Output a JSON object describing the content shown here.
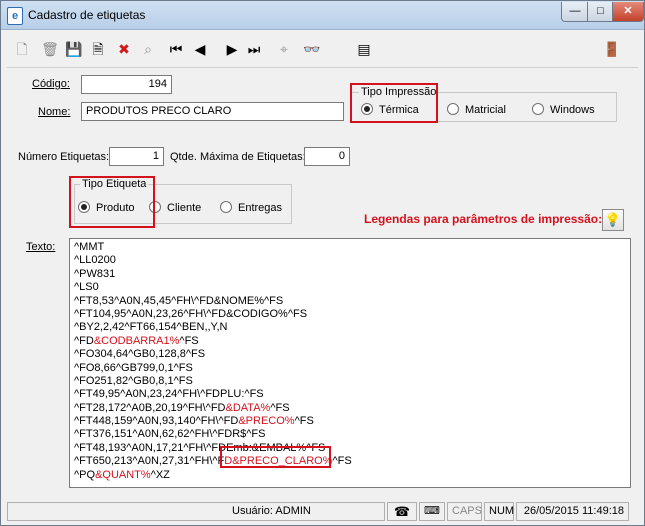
{
  "window": {
    "title": "Cadastro de etiquetas",
    "minimize": "—",
    "maximize": "□",
    "close": "✕"
  },
  "toolbar": {
    "icons": [
      {
        "name": "new-icon",
        "glyph": "🗋"
      },
      {
        "name": "trash-icon",
        "glyph": "🗑"
      },
      {
        "name": "save-icon",
        "glyph": "💾"
      },
      {
        "name": "edit-icon",
        "glyph": "🗎"
      },
      {
        "name": "delete-icon",
        "glyph": "✖"
      },
      {
        "name": "search-icon",
        "glyph": "⌕"
      },
      {
        "name": "first-record-icon",
        "glyph": "⏮"
      },
      {
        "name": "previous-record-icon",
        "glyph": "◀"
      },
      {
        "name": "next-record-icon",
        "glyph": "▶"
      },
      {
        "name": "last-record-icon",
        "glyph": "⏭"
      },
      {
        "name": "filter-icon",
        "glyph": "⌖"
      },
      {
        "name": "binoculars-icon",
        "glyph": "👓"
      },
      {
        "name": "report-icon",
        "glyph": "▤"
      },
      {
        "name": "exit-icon",
        "glyph": "🚪"
      }
    ]
  },
  "form": {
    "codigo_label": "Código:",
    "codigo_value": "194",
    "nome_label": "Nome:",
    "nome_value": "PRODUTOS PRECO CLARO",
    "tipo_impressao": {
      "title": "Tipo Impressão",
      "options": [
        "Térmica",
        "Matricial",
        "Windows"
      ],
      "selected": "Térmica"
    },
    "numero_etiquetas_label": "Número Etiquetas:",
    "numero_etiquetas_value": "1",
    "qtde_maxima_label": "Qtde. Máxima de Etiquetas:",
    "qtde_maxima_value": "0",
    "tipo_etiqueta": {
      "title": "Tipo Etiqueta",
      "options": [
        "Produto",
        "Cliente",
        "Entregas"
      ],
      "selected": "Produto"
    },
    "legend_text": "Legendas para parâmetros de impressão:",
    "texto_label": "Texto:"
  },
  "texto_lines": [
    [
      {
        "t": "^MMT"
      }
    ],
    [
      {
        "t": "^LL0200"
      }
    ],
    [
      {
        "t": "^PW831"
      }
    ],
    [
      {
        "t": "^LS0"
      }
    ],
    [
      {
        "t": "^FT8,53^A0N,45,45^FH\\^FD&NOME%^FS"
      }
    ],
    [
      {
        "t": "^FT104,95^A0N,23,26^FH\\^FD&CODIGO%^FS"
      }
    ],
    [
      {
        "t": "^BY2,2,42^FT66,154^BEN,,Y,N"
      }
    ],
    [
      {
        "t": "^FD"
      },
      {
        "t": "&CODBARRA1%",
        "red": true
      },
      {
        "t": "^FS"
      }
    ],
    [
      {
        "t": "^FO304,64^GB0,128,8^FS"
      }
    ],
    [
      {
        "t": "^FO8,66^GB799,0,1^FS"
      }
    ],
    [
      {
        "t": "^FO251,82^GB0,8,1^FS"
      }
    ],
    [
      {
        "t": "^FT49,95^A0N,23,24^FH\\^FDPLU:^FS"
      }
    ],
    [
      {
        "t": "^FT28,172^A0B,20,19^FH\\^FD"
      },
      {
        "t": "&DATA%",
        "red": true
      },
      {
        "t": "^FS"
      }
    ],
    [
      {
        "t": "^FT448,159^A0N,93,140^FH\\^FD"
      },
      {
        "t": "&PRECO%",
        "red": true
      },
      {
        "t": "^FS"
      }
    ],
    [
      {
        "t": "^FT376,151^A0N,62,62^FH\\^FDR$^FS"
      }
    ],
    [
      {
        "t": "^FT48,193^A0N,17,21^FH\\^FDEmb:&EMBAL%^FS"
      }
    ],
    [
      {
        "t": "^FT650,213^A0N,27,31^FH\\^F"
      },
      {
        "t": "D&PRECO_CLARO%",
        "red": true
      },
      {
        "t": "^FS"
      }
    ],
    [
      {
        "t": "^PQ"
      },
      {
        "t": "&QUANT%",
        "red": true
      },
      {
        "t": "^XZ"
      }
    ]
  ],
  "status": {
    "user": "Usuário: ADMIN",
    "caps": "CAPS",
    "num": "NUM",
    "datetime": "26/05/2015 11:49:18"
  }
}
